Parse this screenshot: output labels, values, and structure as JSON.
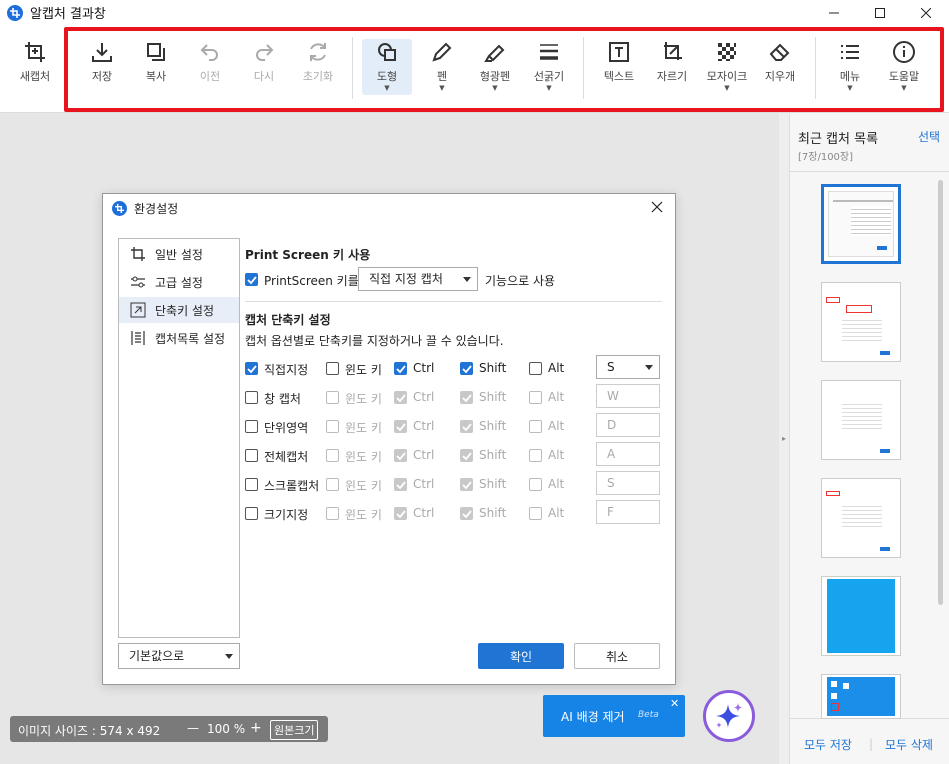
{
  "window": {
    "title": "알캡처 결과창"
  },
  "toolbar": {
    "new_capture": "새캡처",
    "save": "저장",
    "copy": "복사",
    "undo": "이전",
    "redo": "다시",
    "reset": "초기화",
    "shape": "도형",
    "pen": "펜",
    "highlighter": "형광펜",
    "line_width": "선굵기",
    "text": "텍스트",
    "crop": "자르기",
    "mosaic": "모자이크",
    "eraser": "지우개",
    "menu": "메뉴",
    "help": "도움말"
  },
  "sidebar": {
    "title": "최근 캡처 목록",
    "select": "선택",
    "count": "[7장/100장]",
    "save_all": "모두 저장",
    "delete_all": "모두 삭제"
  },
  "dialog": {
    "title": "환경설정",
    "nav": [
      "일반 설정",
      "고급 설정",
      "단축키 설정",
      "캡처목록 설정"
    ],
    "printscreen_heading": "Print Screen 키 사용",
    "printscreen_label": "PrintScreen 키를",
    "printscreen_value": "직접 지정 캡처",
    "printscreen_suffix": "기능으로 사용",
    "shortcut_heading": "캡처 단축키 설정",
    "shortcut_desc": "캡처 옵션별로 단축키를 지정하거나 끌 수 있습니다.",
    "mod_window": "윈도 키",
    "mod_ctrl": "Ctrl",
    "mod_shift": "Shift",
    "mod_alt": "Alt",
    "rows": [
      {
        "name": "직접지정",
        "key": "S",
        "enabled": true
      },
      {
        "name": "창 캡처",
        "key": "W",
        "enabled": false
      },
      {
        "name": "단위영역",
        "key": "D",
        "enabled": false
      },
      {
        "name": "전체캡처",
        "key": "A",
        "enabled": false
      },
      {
        "name": "스크롤캡처",
        "key": "S",
        "enabled": false
      },
      {
        "name": "크기지정",
        "key": "F",
        "enabled": false
      }
    ],
    "defaults_button": "기본값으로",
    "ok_button": "확인",
    "cancel_button": "취소"
  },
  "status": {
    "image_size": "이미지 사이즈 : 574 x 492",
    "zoom_minus": "—",
    "zoom": "100 %",
    "zoom_plus": "+",
    "original_size": "원본크기"
  },
  "ai": {
    "label": "AI 배경 제거",
    "beta": "Beta"
  },
  "colors": {
    "accent": "#1f74d4",
    "highlight": "#e8141d",
    "ai_blue": "#1683e6"
  }
}
